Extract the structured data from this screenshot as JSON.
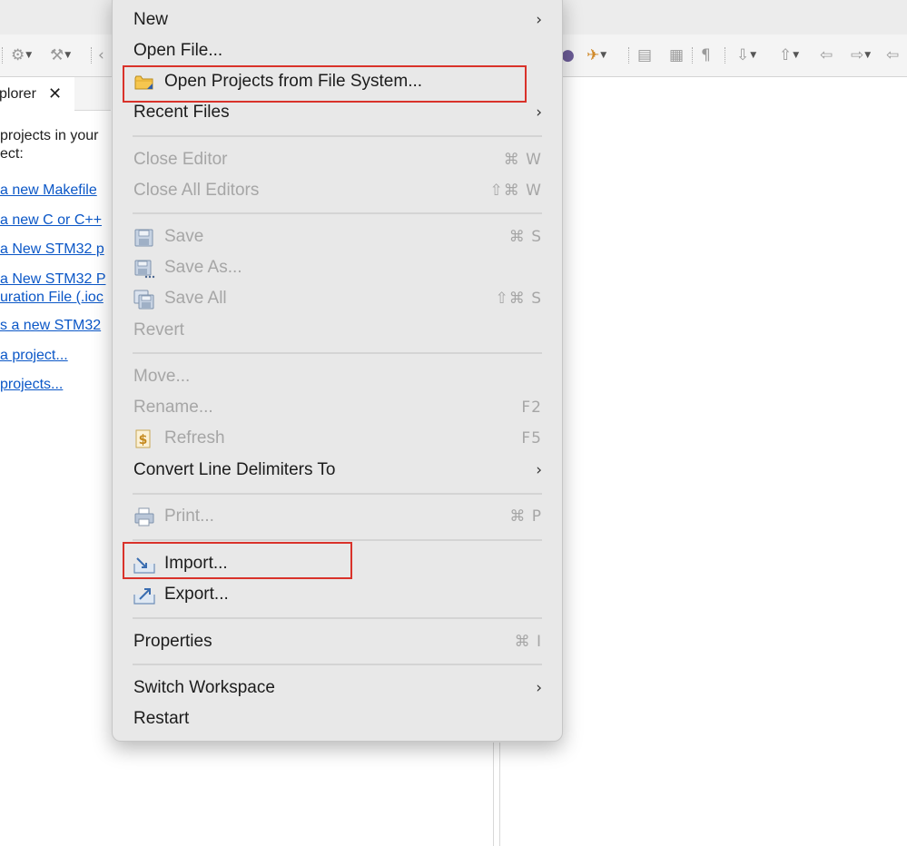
{
  "explorer": {
    "tab_label": "plorer",
    "tab_close": "✕",
    "intro_line1": "projects in your",
    "intro_line2": "ect:",
    "links": [
      "a new Makefile",
      "a new C or C++",
      "a New STM32 p",
      "a New STM32 P",
      "uration File (.ioc",
      "s a new STM32",
      "a project...",
      "projects..."
    ]
  },
  "menu": {
    "new": "New",
    "open_file": "Open File...",
    "open_projects": "Open Projects from File System...",
    "recent_files": "Recent Files",
    "close_editor": "Close Editor",
    "close_editor_shortcut": "⌘ W",
    "close_all_editors": "Close All Editors",
    "close_all_editors_shortcut": "⇧⌘ W",
    "save": "Save",
    "save_shortcut": "⌘ S",
    "save_as": "Save As...",
    "save_all": "Save All",
    "save_all_shortcut": "⇧⌘ S",
    "revert": "Revert",
    "move": "Move...",
    "rename": "Rename...",
    "rename_shortcut": "F2",
    "refresh": "Refresh",
    "refresh_shortcut": "F5",
    "convert_line_delimiters": "Convert Line Delimiters To",
    "print": "Print...",
    "print_shortcut": "⌘ P",
    "import": "Import...",
    "export": "Export...",
    "properties": "Properties",
    "properties_shortcut": "⌘ I",
    "switch_workspace": "Switch Workspace",
    "restart": "Restart",
    "submenu_arrow": "›"
  },
  "colors": {
    "highlight_box": "#d9322a",
    "link": "#0b57c7",
    "disabled_text": "#a6a6a6"
  },
  "icons": [
    "folder-icon",
    "save-icon",
    "save-as-icon",
    "save-all-icon",
    "refresh-icon",
    "print-icon",
    "import-icon",
    "export-icon",
    "close-icon",
    "chevron-right-icon"
  ]
}
